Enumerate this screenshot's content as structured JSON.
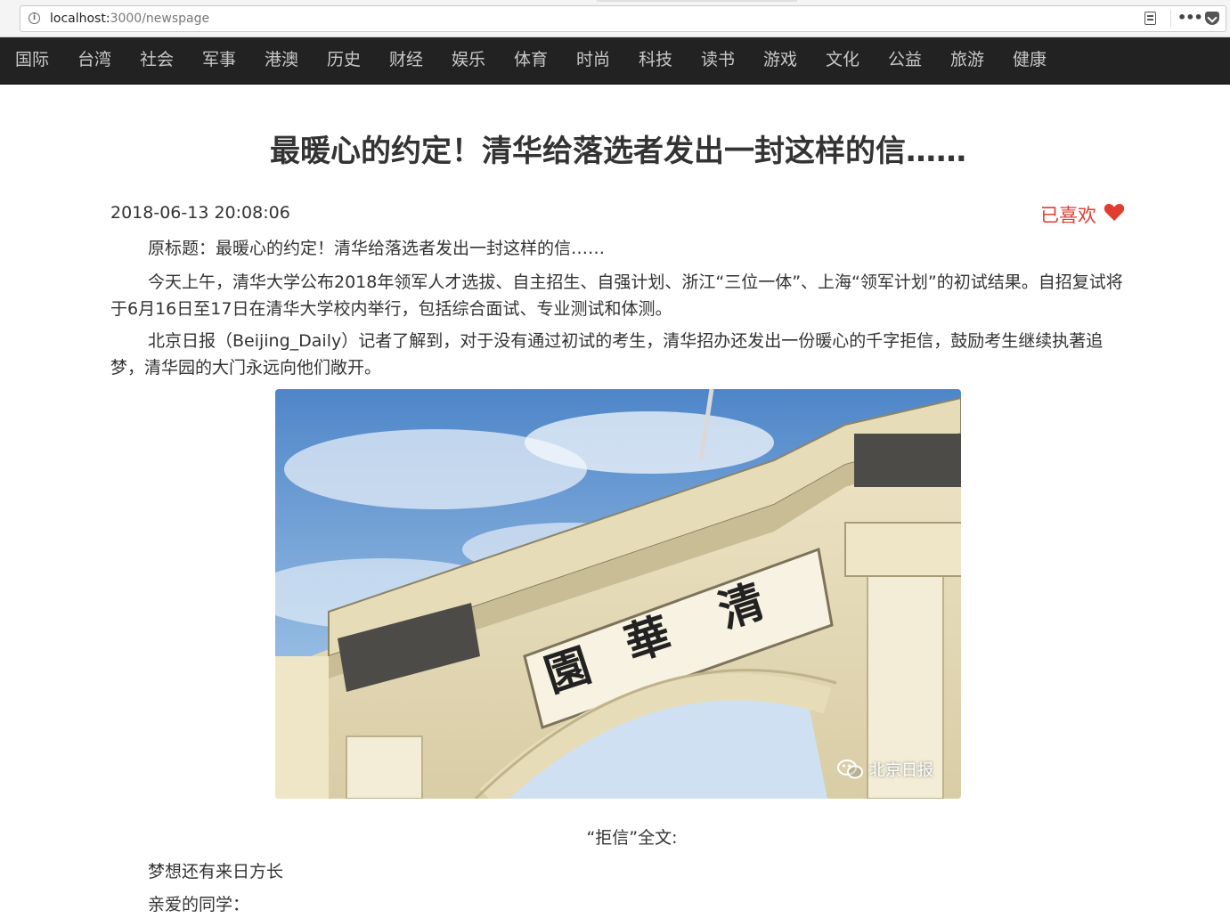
{
  "browser": {
    "url_host": "localhost:",
    "url_path": "3000/newspage"
  },
  "nav": {
    "items": [
      "国际",
      "台湾",
      "社会",
      "军事",
      "港澳",
      "历史",
      "财经",
      "娱乐",
      "体育",
      "时尚",
      "科技",
      "读书",
      "游戏",
      "文化",
      "公益",
      "旅游",
      "健康"
    ]
  },
  "article": {
    "title": "最暖心的约定！清华给落选者发出一封这样的信……",
    "date": "2018-06-13 20:08:06",
    "like_label": "已喜欢",
    "paragraphs": [
      "原标题：最暖心的约定！清华给落选者发出一封这样的信……",
      "今天上午，清华大学公布2018年领军人才选拔、自主招生、自强计划、浙江“三位一体”、上海“领军计划”的初试结果。自招复试将于6月16日至17日在清华大学校内举行，包括综合面试、专业测试和体测。",
      "北京日报（Beijing_Daily）记者了解到，对于没有通过初试的考生，清华招办还发出一份暖心的千字拒信，鼓励考生继续执著追梦，清华园的大门永远向他们敞开。"
    ],
    "image": {
      "plaque_text": "清華園",
      "watermark": "北京日报"
    },
    "caption": "“拒信”全文:",
    "letter": [
      "梦想还有来日方长",
      "亲爱的同学："
    ]
  },
  "colors": {
    "nav_bg": "#222222",
    "nav_text": "#c8c8c8",
    "like": "#e23b30"
  }
}
